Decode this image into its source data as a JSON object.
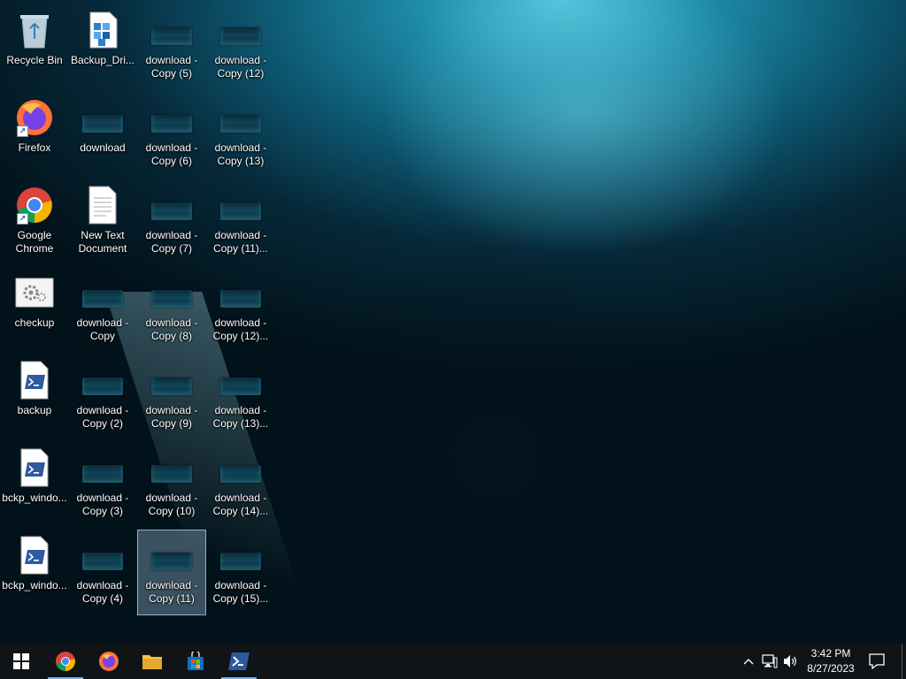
{
  "desktop": {
    "icons": [
      {
        "label": "Recycle Bin",
        "type": "recycle"
      },
      {
        "label": "Backup_Dri...",
        "type": "registry"
      },
      {
        "label": "download - Copy (5)",
        "type": "thumb"
      },
      {
        "label": "download - Copy (12)",
        "type": "thumb"
      },
      {
        "label": "Firefox",
        "type": "firefox"
      },
      {
        "label": "download",
        "type": "thumb"
      },
      {
        "label": "download - Copy (6)",
        "type": "thumb"
      },
      {
        "label": "download - Copy (13)",
        "type": "thumb"
      },
      {
        "label": "Google Chrome",
        "type": "chrome"
      },
      {
        "label": "New Text Document",
        "type": "text"
      },
      {
        "label": "download - Copy (7)",
        "type": "thumb"
      },
      {
        "label": "download - Copy (11)...",
        "type": "thumb"
      },
      {
        "label": "checkup",
        "type": "settings"
      },
      {
        "label": "download - Copy",
        "type": "thumb"
      },
      {
        "label": "download - Copy (8)",
        "type": "thumb"
      },
      {
        "label": "download - Copy (12)...",
        "type": "thumb"
      },
      {
        "label": "backup",
        "type": "ps1"
      },
      {
        "label": "download - Copy (2)",
        "type": "thumb"
      },
      {
        "label": "download - Copy (9)",
        "type": "thumb"
      },
      {
        "label": "download - Copy (13)...",
        "type": "thumb"
      },
      {
        "label": "bckp_windo...",
        "type": "ps1"
      },
      {
        "label": "download - Copy (3)",
        "type": "thumb"
      },
      {
        "label": "download - Copy (10)",
        "type": "thumb"
      },
      {
        "label": "download - Copy (14)...",
        "type": "thumb"
      },
      {
        "label": "bckp_windo...",
        "type": "ps1"
      },
      {
        "label": "download - Copy (4)",
        "type": "thumb"
      },
      {
        "label": "download - Copy (11)",
        "type": "thumb",
        "selected": true
      },
      {
        "label": "download - Copy (15)...",
        "type": "thumb"
      }
    ]
  },
  "taskbar": {
    "apps": [
      {
        "name": "start",
        "icon": "windows-logo-icon"
      },
      {
        "name": "chrome",
        "icon": "chrome-icon",
        "active": true
      },
      {
        "name": "firefox",
        "icon": "firefox-icon"
      },
      {
        "name": "file-explorer",
        "icon": "folder-icon"
      },
      {
        "name": "microsoft-store",
        "icon": "store-icon"
      },
      {
        "name": "powershell",
        "icon": "powershell-icon",
        "active": true
      }
    ],
    "tray": {
      "time": "3:42 PM",
      "date": "8/27/2023"
    }
  },
  "colors": {
    "taskbar": "#101417",
    "active_indicator": "#7ab7e8",
    "selection": "#a0c8e6"
  }
}
